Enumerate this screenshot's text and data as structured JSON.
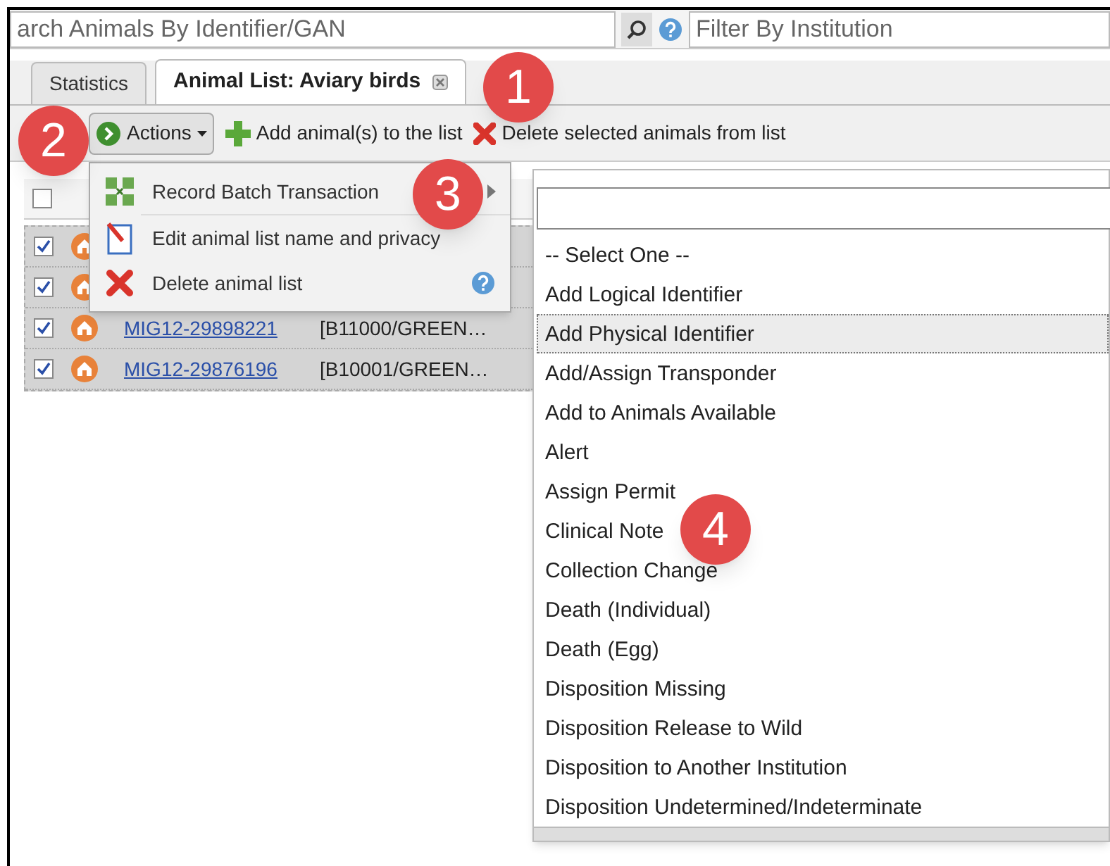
{
  "search": {
    "placeholder": "arch Animals By Identifier/GAN"
  },
  "filter": {
    "placeholder": "Filter By Institution"
  },
  "tabs": [
    {
      "label": "Statistics",
      "selected": false,
      "closable": false
    },
    {
      "label": "Animal List: Aviary birds",
      "selected": true,
      "closable": true
    }
  ],
  "toolbar": {
    "actions": "Actions",
    "add": "Add animal(s) to the list",
    "delete": "Delete selected animals from list"
  },
  "table": {
    "header_checked": false,
    "rows": [
      {
        "checked": true
      },
      {
        "checked": true
      },
      {
        "checked": true,
        "id": "MIG12-29898221",
        "identifier": "[B11000/GREEN…"
      },
      {
        "checked": true,
        "id": "MIG12-29876196",
        "identifier": "[B10001/GREEN…"
      }
    ]
  },
  "actions_menu": [
    {
      "label": "Record Batch Transaction",
      "submenu": true,
      "help": false
    },
    {
      "label": "Edit animal list name and privacy",
      "submenu": false,
      "help": false
    },
    {
      "label": "Delete animal list",
      "submenu": false,
      "help": true
    }
  ],
  "transaction_select": {
    "options": [
      {
        "label": "-- Select One --",
        "selected": false
      },
      {
        "label": "Add Logical Identifier",
        "selected": false
      },
      {
        "label": "Add Physical Identifier",
        "selected": true
      },
      {
        "label": "Add/Assign Transponder",
        "selected": false
      },
      {
        "label": "Add to Animals Available",
        "selected": false
      },
      {
        "label": "Alert",
        "selected": false
      },
      {
        "label": "Assign Permit",
        "selected": false
      },
      {
        "label": "Clinical Note",
        "selected": false
      },
      {
        "label": "Collection Change",
        "selected": false
      },
      {
        "label": "Death (Individual)",
        "selected": false
      },
      {
        "label": "Death (Egg)",
        "selected": false
      },
      {
        "label": "Disposition Missing",
        "selected": false
      },
      {
        "label": "Disposition Release to Wild",
        "selected": false
      },
      {
        "label": "Disposition to Another Institution",
        "selected": false
      },
      {
        "label": "Disposition Undetermined/Indeterminate",
        "selected": false
      }
    ]
  },
  "callouts": [
    "1",
    "2",
    "3",
    "4"
  ]
}
